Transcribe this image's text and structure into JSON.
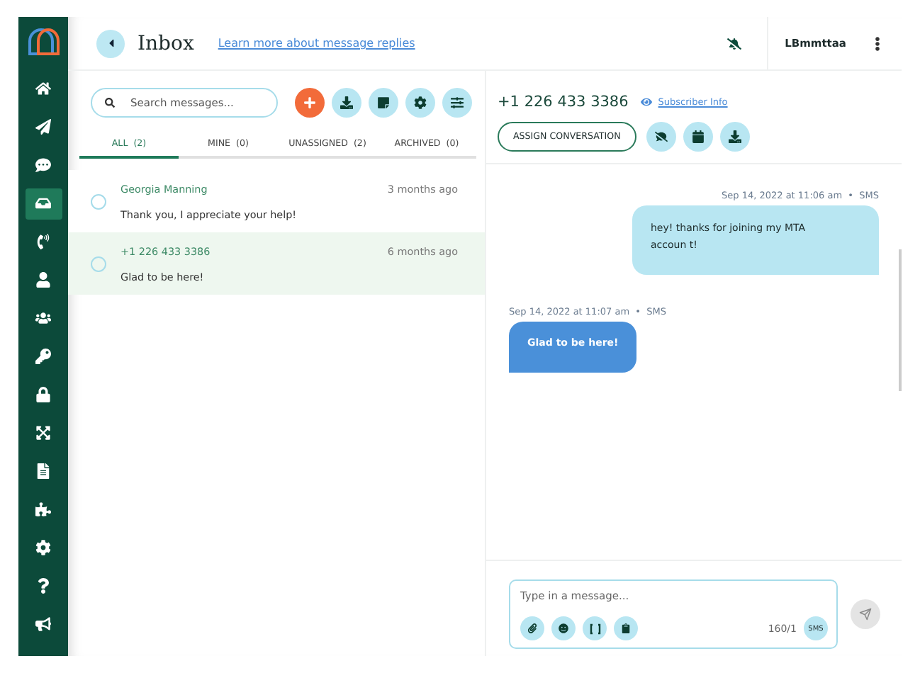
{
  "sidebar": {
    "items": [
      {
        "selected": false
      },
      {
        "selected": false
      },
      {
        "selected": false
      },
      {
        "selected": true
      },
      {
        "selected": false
      },
      {
        "selected": false
      },
      {
        "selected": false
      },
      {
        "selected": false
      },
      {
        "selected": false
      },
      {
        "selected": false
      },
      {
        "selected": false
      },
      {
        "selected": false
      },
      {
        "selected": false
      },
      {
        "selected": false
      },
      {
        "selected": false
      }
    ]
  },
  "header": {
    "title": "Inbox",
    "help_link": "Learn more about message replies",
    "user": "LBmmttaa"
  },
  "search": {
    "placeholder": "Search messages..."
  },
  "tabs": [
    {
      "label": "ALL  (2)",
      "selected": true
    },
    {
      "label": "MINE  (0)",
      "selected": false
    },
    {
      "label": "UNASSIGNED  (2)",
      "selected": false
    },
    {
      "label": "ARCHIVED  (0)",
      "selected": false
    }
  ],
  "conversations": [
    {
      "name": "Georgia Manning",
      "preview": "Thank you, I appreciate your help!",
      "time": "3 months ago",
      "selected": false,
      "checked": false
    },
    {
      "name": "+1 226 433 3386",
      "preview": "Glad to be here!",
      "time": "6 months ago",
      "selected": true,
      "checked": false
    }
  ],
  "conversation": {
    "phone": "+1 226 433 3386",
    "subscriber_link": "Subscriber Info",
    "assign_button": "ASSIGN CONVERSATION",
    "messages": [
      {
        "kind": "outgoing",
        "meta": "Sep 14, 2022 at 11:06 am  •  SMS",
        "text": "hey! thanks for joining my MTA accoun t!"
      },
      {
        "kind": "incoming",
        "meta": "Sep 14, 2022 at 11:07 am  •  SMS",
        "text": "Glad to be here!"
      }
    ]
  },
  "composer": {
    "placeholder": "Type in a message...",
    "counter": "160/1",
    "channel": "SMS"
  }
}
